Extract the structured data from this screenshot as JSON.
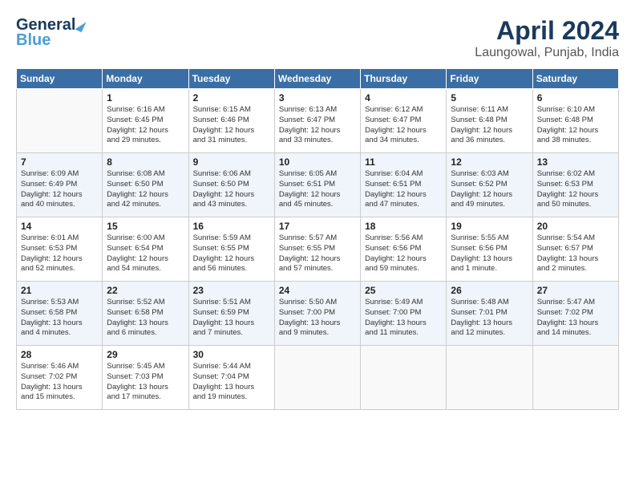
{
  "header": {
    "logo_line1": "General",
    "logo_line2": "Blue",
    "month": "April 2024",
    "location": "Laungowal, Punjab, India"
  },
  "weekdays": [
    "Sunday",
    "Monday",
    "Tuesday",
    "Wednesday",
    "Thursday",
    "Friday",
    "Saturday"
  ],
  "weeks": [
    [
      {
        "day": "",
        "info": ""
      },
      {
        "day": "1",
        "info": "Sunrise: 6:16 AM\nSunset: 6:45 PM\nDaylight: 12 hours\nand 29 minutes."
      },
      {
        "day": "2",
        "info": "Sunrise: 6:15 AM\nSunset: 6:46 PM\nDaylight: 12 hours\nand 31 minutes."
      },
      {
        "day": "3",
        "info": "Sunrise: 6:13 AM\nSunset: 6:47 PM\nDaylight: 12 hours\nand 33 minutes."
      },
      {
        "day": "4",
        "info": "Sunrise: 6:12 AM\nSunset: 6:47 PM\nDaylight: 12 hours\nand 34 minutes."
      },
      {
        "day": "5",
        "info": "Sunrise: 6:11 AM\nSunset: 6:48 PM\nDaylight: 12 hours\nand 36 minutes."
      },
      {
        "day": "6",
        "info": "Sunrise: 6:10 AM\nSunset: 6:48 PM\nDaylight: 12 hours\nand 38 minutes."
      }
    ],
    [
      {
        "day": "7",
        "info": "Sunrise: 6:09 AM\nSunset: 6:49 PM\nDaylight: 12 hours\nand 40 minutes."
      },
      {
        "day": "8",
        "info": "Sunrise: 6:08 AM\nSunset: 6:50 PM\nDaylight: 12 hours\nand 42 minutes."
      },
      {
        "day": "9",
        "info": "Sunrise: 6:06 AM\nSunset: 6:50 PM\nDaylight: 12 hours\nand 43 minutes."
      },
      {
        "day": "10",
        "info": "Sunrise: 6:05 AM\nSunset: 6:51 PM\nDaylight: 12 hours\nand 45 minutes."
      },
      {
        "day": "11",
        "info": "Sunrise: 6:04 AM\nSunset: 6:51 PM\nDaylight: 12 hours\nand 47 minutes."
      },
      {
        "day": "12",
        "info": "Sunrise: 6:03 AM\nSunset: 6:52 PM\nDaylight: 12 hours\nand 49 minutes."
      },
      {
        "day": "13",
        "info": "Sunrise: 6:02 AM\nSunset: 6:53 PM\nDaylight: 12 hours\nand 50 minutes."
      }
    ],
    [
      {
        "day": "14",
        "info": "Sunrise: 6:01 AM\nSunset: 6:53 PM\nDaylight: 12 hours\nand 52 minutes."
      },
      {
        "day": "15",
        "info": "Sunrise: 6:00 AM\nSunset: 6:54 PM\nDaylight: 12 hours\nand 54 minutes."
      },
      {
        "day": "16",
        "info": "Sunrise: 5:59 AM\nSunset: 6:55 PM\nDaylight: 12 hours\nand 56 minutes."
      },
      {
        "day": "17",
        "info": "Sunrise: 5:57 AM\nSunset: 6:55 PM\nDaylight: 12 hours\nand 57 minutes."
      },
      {
        "day": "18",
        "info": "Sunrise: 5:56 AM\nSunset: 6:56 PM\nDaylight: 12 hours\nand 59 minutes."
      },
      {
        "day": "19",
        "info": "Sunrise: 5:55 AM\nSunset: 6:56 PM\nDaylight: 13 hours\nand 1 minute."
      },
      {
        "day": "20",
        "info": "Sunrise: 5:54 AM\nSunset: 6:57 PM\nDaylight: 13 hours\nand 2 minutes."
      }
    ],
    [
      {
        "day": "21",
        "info": "Sunrise: 5:53 AM\nSunset: 6:58 PM\nDaylight: 13 hours\nand 4 minutes."
      },
      {
        "day": "22",
        "info": "Sunrise: 5:52 AM\nSunset: 6:58 PM\nDaylight: 13 hours\nand 6 minutes."
      },
      {
        "day": "23",
        "info": "Sunrise: 5:51 AM\nSunset: 6:59 PM\nDaylight: 13 hours\nand 7 minutes."
      },
      {
        "day": "24",
        "info": "Sunrise: 5:50 AM\nSunset: 7:00 PM\nDaylight: 13 hours\nand 9 minutes."
      },
      {
        "day": "25",
        "info": "Sunrise: 5:49 AM\nSunset: 7:00 PM\nDaylight: 13 hours\nand 11 minutes."
      },
      {
        "day": "26",
        "info": "Sunrise: 5:48 AM\nSunset: 7:01 PM\nDaylight: 13 hours\nand 12 minutes."
      },
      {
        "day": "27",
        "info": "Sunrise: 5:47 AM\nSunset: 7:02 PM\nDaylight: 13 hours\nand 14 minutes."
      }
    ],
    [
      {
        "day": "28",
        "info": "Sunrise: 5:46 AM\nSunset: 7:02 PM\nDaylight: 13 hours\nand 15 minutes."
      },
      {
        "day": "29",
        "info": "Sunrise: 5:45 AM\nSunset: 7:03 PM\nDaylight: 13 hours\nand 17 minutes."
      },
      {
        "day": "30",
        "info": "Sunrise: 5:44 AM\nSunset: 7:04 PM\nDaylight: 13 hours\nand 19 minutes."
      },
      {
        "day": "",
        "info": ""
      },
      {
        "day": "",
        "info": ""
      },
      {
        "day": "",
        "info": ""
      },
      {
        "day": "",
        "info": ""
      }
    ]
  ]
}
